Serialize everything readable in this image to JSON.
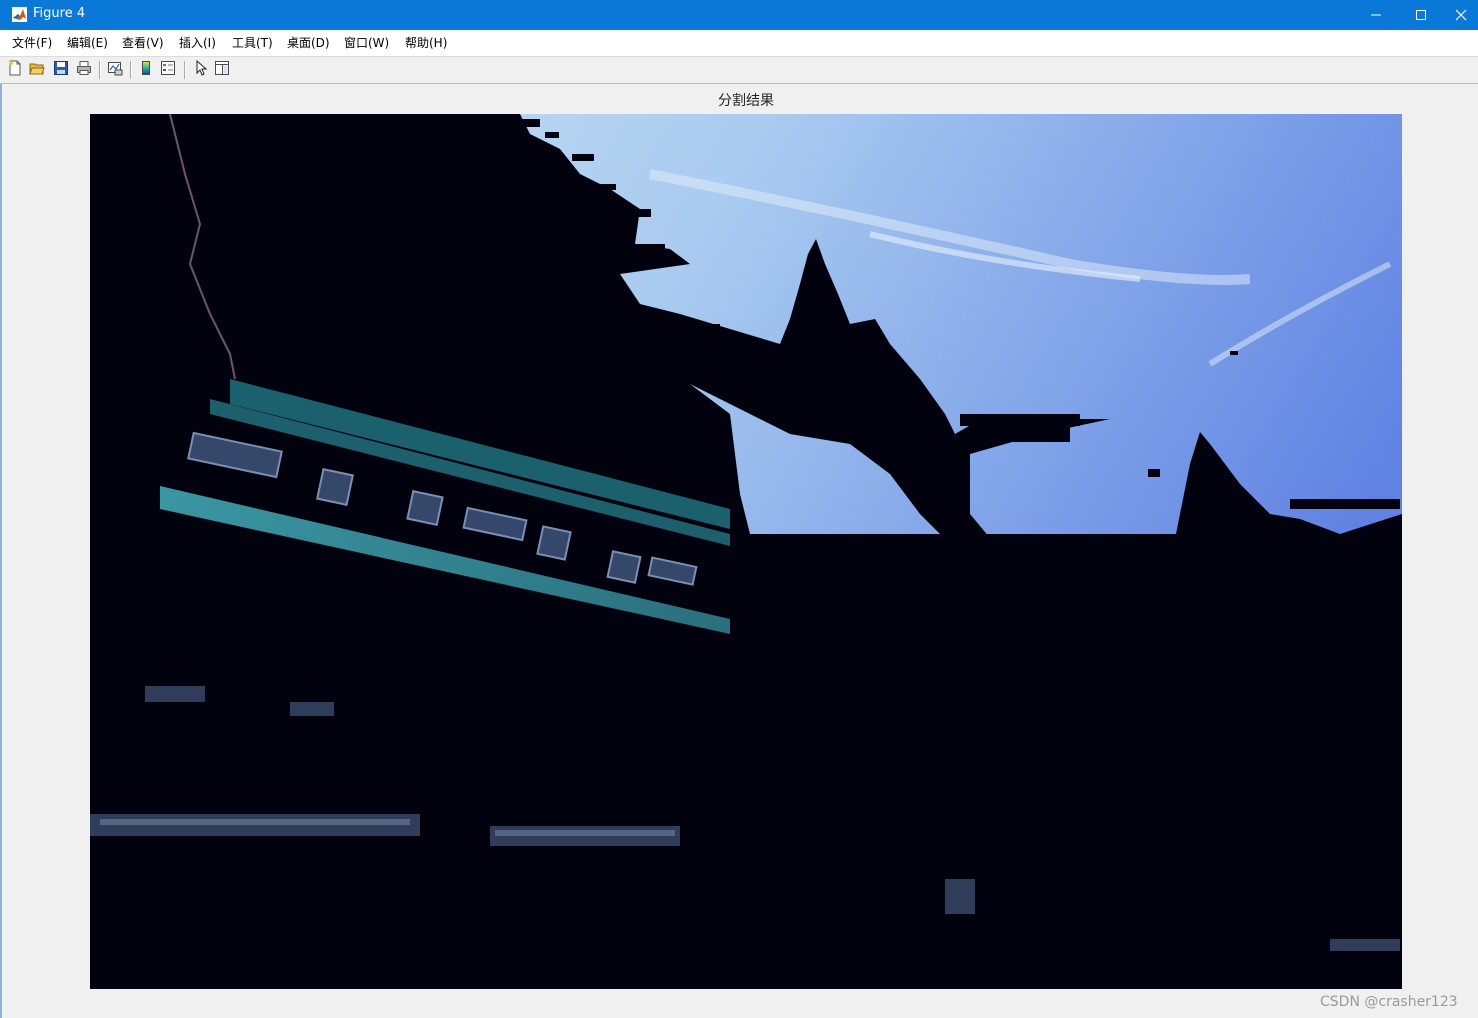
{
  "window": {
    "title": "Figure 4",
    "controls": {
      "minimize": "minimize-icon",
      "maximize": "maximize-icon",
      "close": "close-icon"
    }
  },
  "menu": {
    "items": [
      {
        "label": "文件(F)"
      },
      {
        "label": "编辑(E)"
      },
      {
        "label": "查看(V)"
      },
      {
        "label": "插入(I)"
      },
      {
        "label": "工具(T)"
      },
      {
        "label": "桌面(D)"
      },
      {
        "label": "窗口(W)"
      },
      {
        "label": "帮助(H)"
      }
    ]
  },
  "toolbar": {
    "buttons": [
      {
        "icon": "new-figure-icon"
      },
      {
        "icon": "open-file-icon"
      },
      {
        "icon": "save-icon"
      },
      {
        "icon": "print-icon"
      },
      {
        "icon": "link-plot-icon"
      },
      {
        "icon": "insert-colorbar-icon"
      },
      {
        "icon": "insert-legend-icon"
      },
      {
        "icon": "edit-plot-pointer-icon"
      },
      {
        "icon": "property-inspector-icon"
      }
    ]
  },
  "axes": {
    "title": "分割结果"
  },
  "watermark": "CSDN @crasher123",
  "colors": {
    "titlebar": "#0a78d7",
    "figure_background": "#f0f0f0",
    "image_dark": "#02020e",
    "sky_light": "#b4d2f2",
    "sky_deep": "#6e8fe6",
    "roof_teal": "#2f7f8c"
  }
}
